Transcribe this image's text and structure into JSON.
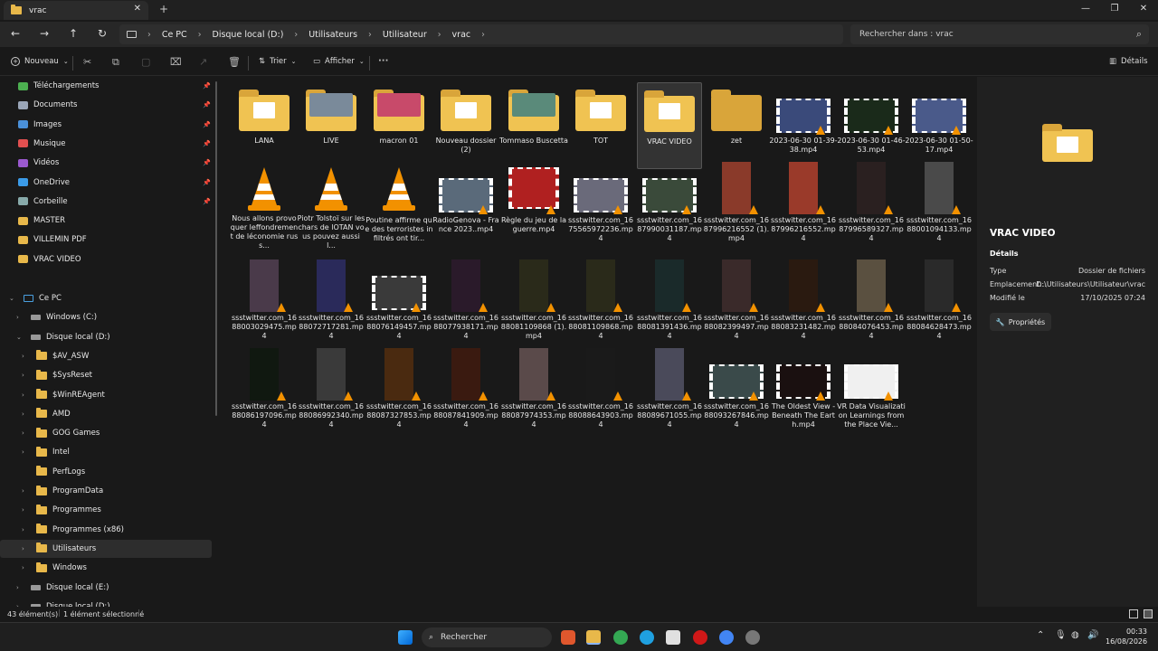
{
  "tab": {
    "title": "vrac",
    "close": "✕",
    "new": "+"
  },
  "window": {
    "minimize": "—",
    "maximize": "❐",
    "close": "✕"
  },
  "nav": {
    "back": "←",
    "forward": "→",
    "up": "↑",
    "refresh": "↻"
  },
  "breadcrumb": [
    "Ce PC",
    "Disque local (D:)",
    "Utilisateurs",
    "Utilisateur",
    "vrac"
  ],
  "search": {
    "placeholder": "Rechercher dans : vrac"
  },
  "commands": {
    "new": "Nouveau",
    "sort": "Trier",
    "view": "Afficher",
    "more": "···",
    "details": "Détails"
  },
  "sidebar": {
    "quick": [
      {
        "label": "Téléchargements",
        "icon": "download-icon",
        "color": "#4caf50"
      },
      {
        "label": "Documents",
        "icon": "documents-icon",
        "color": "#9aa6b8"
      },
      {
        "label": "Images",
        "icon": "images-icon",
        "color": "#4a90d9"
      },
      {
        "label": "Musique",
        "icon": "music-icon",
        "color": "#e25050"
      },
      {
        "label": "Vidéos",
        "icon": "videos-icon",
        "color": "#9b59d0"
      },
      {
        "label": "OneDrive",
        "icon": "onedrive-icon",
        "color": "#3b9be8"
      },
      {
        "label": "Corbeille",
        "icon": "recycle-bin-icon",
        "color": "#8aa"
      },
      {
        "label": "MASTER",
        "icon": "folder-icon",
        "color": "#e8b84a"
      },
      {
        "label": "VILLEMIN PDF",
        "icon": "folder-icon",
        "color": "#e8b84a"
      },
      {
        "label": "VRAC VIDEO",
        "icon": "folder-icon",
        "color": "#e8b84a"
      }
    ],
    "tree": [
      {
        "label": "Ce PC",
        "level": 0
      },
      {
        "label": "Windows (C:)",
        "level": 1
      },
      {
        "label": "Disque local (D:)",
        "level": 1
      },
      {
        "label": "$AV_ASW",
        "level": 2
      },
      {
        "label": "$SysReset",
        "level": 2
      },
      {
        "label": "$WinREAgent",
        "level": 2
      },
      {
        "label": "AMD",
        "level": 2
      },
      {
        "label": "GOG Games",
        "level": 2
      },
      {
        "label": "Intel",
        "level": 2
      },
      {
        "label": "PerfLogs",
        "level": 2
      },
      {
        "label": "ProgramData",
        "level": 2
      },
      {
        "label": "Programmes",
        "level": 2
      },
      {
        "label": "Programmes (x86)",
        "level": 2
      },
      {
        "label": "Utilisateurs",
        "level": 2
      },
      {
        "label": "Windows",
        "level": 2
      },
      {
        "label": "Disque local (E:)",
        "level": 1
      },
      {
        "label": "Disque local (D:)",
        "level": 1
      }
    ]
  },
  "files": [
    {
      "name": "LANA",
      "kind": "folder"
    },
    {
      "name": "LIVE",
      "kind": "folder-pic",
      "color": "#7a8a9a"
    },
    {
      "name": "macron 01",
      "kind": "folder-pic",
      "color": "#c84a6a"
    },
    {
      "name": "Nouveau dossier (2)",
      "kind": "folder"
    },
    {
      "name": "Tommaso Buscetta",
      "kind": "folder-pic",
      "color": "#5a8a7a"
    },
    {
      "name": "TOT",
      "kind": "folder"
    },
    {
      "name": "VRAC VIDEO",
      "kind": "folder",
      "selected": true
    },
    {
      "name": "zet",
      "kind": "folder-dark"
    },
    {
      "name": "2023-06-30 01-39-38.mp4",
      "kind": "video",
      "color": "#3a4a7a"
    },
    {
      "name": "2023-06-30 01-46-53.mp4",
      "kind": "video",
      "color": "#1a2a1a"
    },
    {
      "name": "2023-06-30 01-50-17.mp4",
      "kind": "video",
      "color": "#4a5a8a"
    },
    {
      "name": "Nous allons provoquer leffondrement de léconomie russ...",
      "kind": "vlc"
    },
    {
      "name": "Piotr Tolstoï sur les chars de lOTAN vous pouvez aussi l...",
      "kind": "vlc"
    },
    {
      "name": "Poutine affirme que des terroristes infiltrés ont tir...",
      "kind": "vlc"
    },
    {
      "name": "RadioGenova - France 2023..mp4",
      "kind": "video",
      "color": "#5a6a7a"
    },
    {
      "name": "Règle du jeu de la guerre.mp4",
      "kind": "video-tall",
      "color": "#b02020"
    },
    {
      "name": "ssstwitter.com_1675565972236.mp4",
      "kind": "video",
      "color": "#6a6a7a"
    },
    {
      "name": "ssstwitter.com_1687990031187.mp4",
      "kind": "video",
      "color": "#3a4a3a"
    },
    {
      "name": "ssstwitter.com_1687996216552 (1).mp4",
      "kind": "portrait",
      "color": "#8a3a2a"
    },
    {
      "name": "ssstwitter.com_1687996216552.mp4",
      "kind": "portrait",
      "color": "#9a3a2a"
    },
    {
      "name": "ssstwitter.com_1687996589327.mp4",
      "kind": "portrait",
      "color": "#2a2020"
    },
    {
      "name": "ssstwitter.com_1688001094133.mp4",
      "kind": "portrait",
      "color": "#4a4a4a"
    },
    {
      "name": "ssstwitter.com_1688003029475.mp4",
      "kind": "portrait",
      "color": "#4a3a4a"
    },
    {
      "name": "ssstwitter.com_1688072717281.mp4",
      "kind": "portrait",
      "color": "#2a2a5a"
    },
    {
      "name": "ssstwitter.com_1688076149457.mp4",
      "kind": "video",
      "color": "#3a3a3a"
    },
    {
      "name": "ssstwitter.com_1688077938171.mp4",
      "kind": "portrait",
      "color": "#2a1a2a"
    },
    {
      "name": "ssstwitter.com_1688081109868 (1).mp4",
      "kind": "portrait",
      "color": "#2a2a1a"
    },
    {
      "name": "ssstwitter.com_1688081109868.mp4",
      "kind": "portrait",
      "color": "#2a2a1a"
    },
    {
      "name": "ssstwitter.com_1688081391436.mp4",
      "kind": "portrait",
      "color": "#1a2a2a"
    },
    {
      "name": "ssstwitter.com_1688082399497.mp4",
      "kind": "portrait",
      "color": "#3a2a2a"
    },
    {
      "name": "ssstwitter.com_1688083231482.mp4",
      "kind": "portrait",
      "color": "#2a1a10"
    },
    {
      "name": "ssstwitter.com_1688084076453.mp4",
      "kind": "portrait",
      "color": "#5a5040"
    },
    {
      "name": "ssstwitter.com_1688084628473.mp4",
      "kind": "portrait",
      "color": "#2a2a2a"
    },
    {
      "name": "ssstwitter.com_1688086197096.mp4",
      "kind": "portrait",
      "color": "#101810"
    },
    {
      "name": "ssstwitter.com_1688086992340.mp4",
      "kind": "portrait",
      "color": "#3a3a3a"
    },
    {
      "name": "ssstwitter.com_1688087327853.mp4",
      "kind": "portrait",
      "color": "#4a2a10"
    },
    {
      "name": "ssstwitter.com_1688087841909.mp4",
      "kind": "portrait",
      "color": "#3a1a10"
    },
    {
      "name": "ssstwitter.com_1688087974353.mp4",
      "kind": "portrait",
      "color": "#5a4a4a"
    },
    {
      "name": "ssstwitter.com_1688088643903.mp4",
      "kind": "portrait",
      "color": "#1a1a1a"
    },
    {
      "name": "ssstwitter.com_1688089671055.mp4",
      "kind": "portrait",
      "color": "#4a4a5a"
    },
    {
      "name": "ssstwitter.com_1688093267846.mp4",
      "kind": "video",
      "color": "#3a4a4a"
    },
    {
      "name": "The Oldest View - Beneath The Earth.mp4",
      "kind": "video",
      "color": "#1a1010"
    },
    {
      "name": "VR Data Visualization Learnings from the Place Vie...",
      "kind": "video",
      "color": "#f0f0f0"
    }
  ],
  "details": {
    "title": "VRAC VIDEO",
    "section": "Détails",
    "rows": [
      {
        "k": "Type",
        "v": "Dossier de fichiers"
      },
      {
        "k": "Emplacement...",
        "v": "D:\\Utilisateurs\\Utilisateur\\vrac"
      },
      {
        "k": "Modifié le",
        "v": "17/10/2025 07:24"
      }
    ],
    "properties": "Propriétés"
  },
  "status": {
    "count": "43 élément(s)",
    "selected": "1 élément sélectionné"
  },
  "taskbar": {
    "search": "Rechercher",
    "time": "00:33",
    "date": "16/08/2026"
  }
}
